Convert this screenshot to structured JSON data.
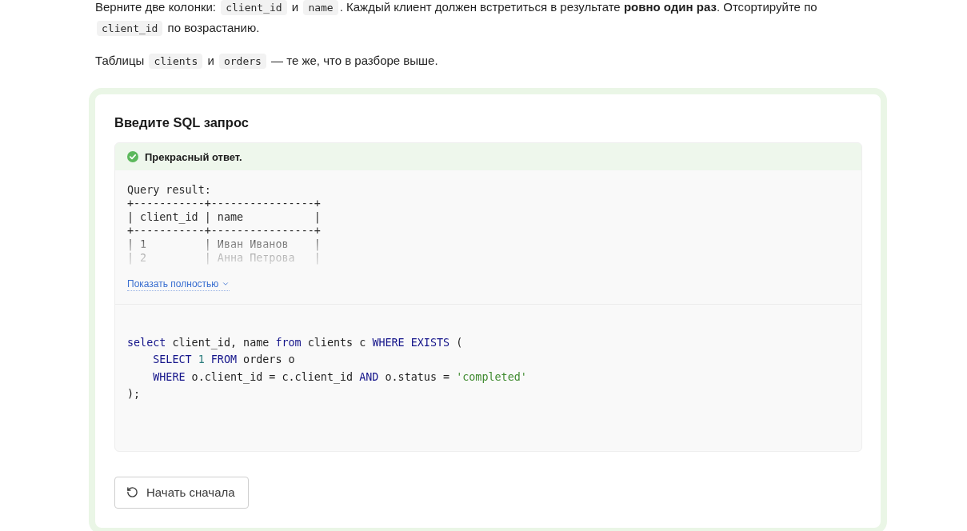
{
  "task": {
    "paragraphs": [
      {
        "segments": [
          {
            "kind": "text",
            "text": "Верните две колонки: "
          },
          {
            "kind": "code",
            "text": "client_id"
          },
          {
            "kind": "text",
            "text": " и "
          },
          {
            "kind": "code",
            "text": "name"
          },
          {
            "kind": "text",
            "text": ". Каждый клиент должен встретиться в результате **ровно один раз**. Отсортируйте по "
          },
          {
            "kind": "code",
            "text": "client_id"
          },
          {
            "kind": "text",
            "text": " по возрастанию."
          }
        ]
      },
      {
        "segments": [
          {
            "kind": "text",
            "text": "Таблицы "
          },
          {
            "kind": "code",
            "text": "clients"
          },
          {
            "kind": "text",
            "text": " и "
          },
          {
            "kind": "code",
            "text": "orders"
          },
          {
            "kind": "text",
            "text": " — те же, что в разборе выше."
          }
        ]
      }
    ]
  },
  "exercise": {
    "title": "Введите SQL запрос",
    "result": {
      "correct": true,
      "message": "Прекрасный ответ.",
      "output_lines": [
        "Query result:",
        "+-----------+----------------+",
        "| client_id | name           |",
        "+-----------+----------------+",
        "| 1         | Иван Иванов    |",
        "| 2         | Анна Петрова   |"
      ],
      "show_more": "Показать полностью"
    },
    "code_lines": [
      {
        "indented": false,
        "tokens": [
          {
            "kind": "keyword",
            "text": "select"
          },
          {
            "kind": "plain",
            "text": " client_id, name "
          },
          {
            "kind": "keyword",
            "text": "from"
          },
          {
            "kind": "plain",
            "text": " clients c "
          },
          {
            "kind": "keyword",
            "text": "WHERE EXISTS"
          },
          {
            "kind": "plain",
            "text": " ("
          }
        ]
      },
      {
        "indented": true,
        "tokens": [
          {
            "kind": "keyword",
            "text": "SELECT"
          },
          {
            "kind": "number",
            "text": " 1"
          },
          {
            "kind": "keyword",
            "text": " FROM"
          },
          {
            "kind": "plain",
            "text": " orders o"
          }
        ]
      },
      {
        "indented": true,
        "tokens": [
          {
            "kind": "keyword",
            "text": "WHERE"
          },
          {
            "kind": "plain",
            "text": " o.client_id = c.client_id "
          },
          {
            "kind": "keyword",
            "text": "AND"
          },
          {
            "kind": "plain",
            "text": " o.status = "
          },
          {
            "kind": "string",
            "text": "'completed'"
          }
        ]
      },
      {
        "indented": false,
        "tokens": [
          {
            "kind": "plain",
            "text": ");"
          }
        ]
      }
    ],
    "reset_button": "Начать сначала"
  }
}
